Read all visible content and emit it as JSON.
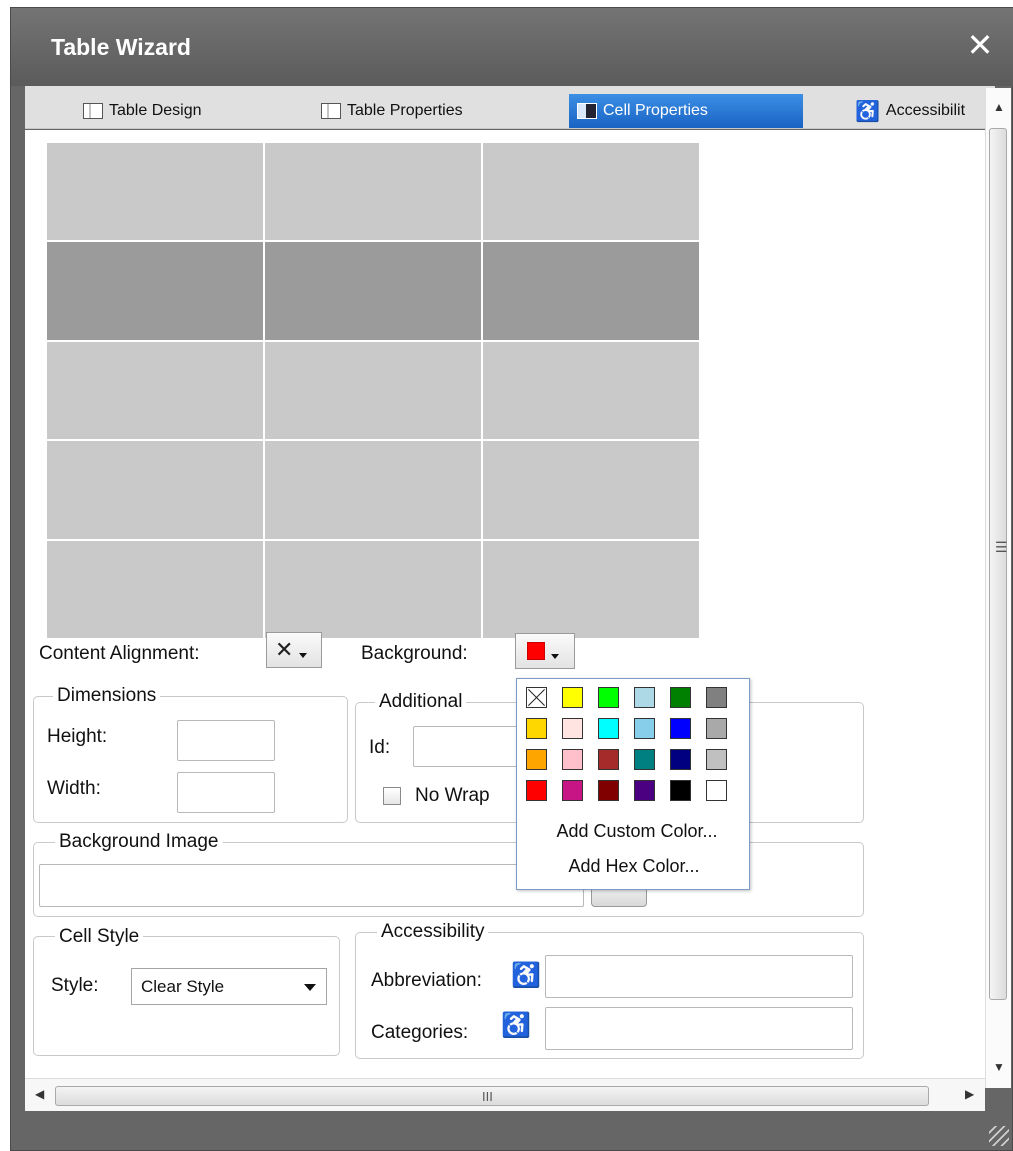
{
  "dialog": {
    "title": "Table Wizard",
    "close_glyph": "✕"
  },
  "tabs": [
    {
      "label": "Table Design"
    },
    {
      "label": "Table Properties"
    },
    {
      "label": "Cell Properties",
      "active": true
    },
    {
      "label": "Accessibilit",
      "icon_glyph": "♿"
    }
  ],
  "cell_properties": {
    "content_alignment_label": "Content Alignment:",
    "content_alignment_glyph": "✕",
    "background_label": "Background:",
    "background_color": "#ff0000",
    "dimensions": {
      "legend": "Dimensions",
      "height_label": "Height:",
      "width_label": "Width:"
    },
    "additional": {
      "legend": "Additional",
      "id_label": "Id:",
      "nowrap_label": "No Wrap"
    },
    "background_image": {
      "legend": "Background Image"
    },
    "cell_style": {
      "legend": "Cell Style",
      "style_label": "Style:",
      "style_value": "Clear Style"
    },
    "accessibility": {
      "legend": "Accessibility",
      "abbreviation_label": "Abbreviation:",
      "categories_label": "Categories:",
      "icon_glyph": "♿"
    }
  },
  "color_palette": {
    "colors": [
      "none",
      "#ffff00",
      "#00ff00",
      "#add8e6",
      "#008000",
      "#808080",
      "#ffd700",
      "#ffe4e1",
      "#00ffff",
      "#87ceeb",
      "#0000ff",
      "#a9a9a9",
      "#ffa500",
      "#ffc0cb",
      "#a52a2a",
      "#008080",
      "#000080",
      "#c0c0c0",
      "#ff0000",
      "#c71585",
      "#800000",
      "#4b0082",
      "#000000",
      "#ffffff"
    ],
    "add_custom_label": "Add Custom Color...",
    "add_hex_label": "Add Hex Color..."
  },
  "scrollbars": {
    "up": "▲",
    "down": "▼",
    "left": "◀",
    "right": "▶",
    "vgrip": "☰",
    "hgrip": "III"
  }
}
